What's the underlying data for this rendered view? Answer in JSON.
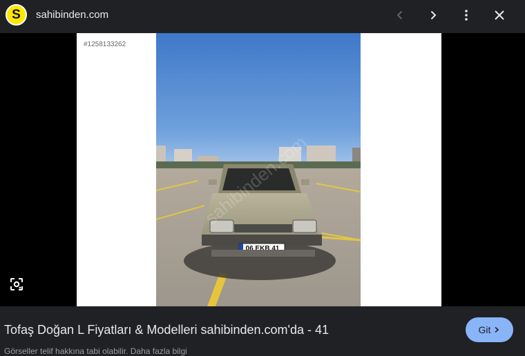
{
  "header": {
    "logo_letter": "S",
    "site_name": "sahibinden.com",
    "icons": [
      "chevron-left-icon",
      "chevron-right-icon",
      "more-vert-icon",
      "close-icon"
    ]
  },
  "viewer": {
    "listing_id": "#1258133262",
    "photo": {
      "description_plate": "06 EKB 41",
      "watermark": "sahibinden.com"
    },
    "lens_icon": "lens-search-icon"
  },
  "footer": {
    "title": "Tofaş Doğan L Fiyatları & Modelleri sahibinden.com'da - 41",
    "button_label": "Git",
    "subtitle": "Görseller telif hakkına tabi olabilir. Daha fazla bilgi"
  },
  "colors": {
    "background": "#202124",
    "accent_button": "#8ab4f8",
    "logo_yellow": "#ffe800"
  }
}
